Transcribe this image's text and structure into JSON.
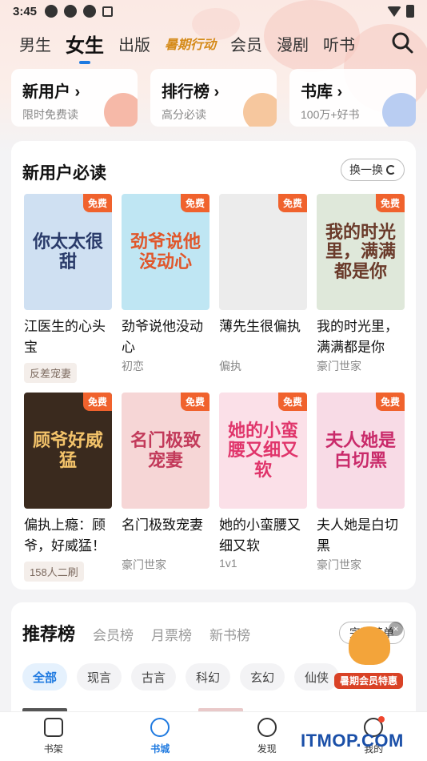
{
  "status_bar": {
    "time": "3:45"
  },
  "top_nav": {
    "tabs": [
      {
        "label": "男生",
        "active": false
      },
      {
        "label": "女生",
        "active": true
      },
      {
        "label": "出版",
        "active": false
      },
      {
        "label": "暑期行动",
        "active": false,
        "special": true
      },
      {
        "label": "会员",
        "active": false
      },
      {
        "label": "漫剧",
        "active": false
      },
      {
        "label": "听书",
        "active": false
      }
    ],
    "search_icon": "search-icon"
  },
  "quick_entries": [
    {
      "title": "新用户 ›",
      "subtitle": "限时免费读",
      "icon": "alarm-clock-icon",
      "icon_color": "#f6b9a8"
    },
    {
      "title": "排行榜 ›",
      "subtitle": "高分必读",
      "icon": "podium-icon",
      "icon_color": "#f6c79e"
    },
    {
      "title": "书库 ›",
      "subtitle": "100万+好书",
      "icon": "books-icon",
      "icon_color": "#b9cdf2"
    }
  ],
  "new_user_section": {
    "title": "新用户必读",
    "refresh_label": "换一换",
    "free_badge": "免费",
    "books": [
      {
        "cover_text": "你太太很甜",
        "name": "江医生的心头宝",
        "tag": "反差宠妻",
        "tag_chip": true,
        "cover_bg": "#cfe0f2",
        "cover_fg": "#2a3b6a"
      },
      {
        "cover_text": "劲爷说他没动心",
        "name": "劲爷说他没动心",
        "tag": "初恋",
        "tag_chip": false,
        "cover_bg": "#bfe6f3",
        "cover_fg": "#e0572b"
      },
      {
        "cover_text": "",
        "name": "薄先生很偏执",
        "tag": "偏执",
        "tag_chip": false,
        "cover_bg": "#ececec",
        "cover_fg": "#999999"
      },
      {
        "cover_text": "我的时光里，满满都是你",
        "name": "我的时光里，满满都是你",
        "tag": "豪门世家",
        "tag_chip": false,
        "cover_bg": "#dfe8da",
        "cover_fg": "#6a3a2a"
      },
      {
        "cover_text": "顾爷好威猛",
        "name": "偏执上瘾：顾爷，好威猛！",
        "tag": "158人二刷",
        "tag_chip": true,
        "cover_bg": "#3a2a1e",
        "cover_fg": "#f3c36a"
      },
      {
        "cover_text": "名门极致宠妻",
        "name": "名门极致宠妻",
        "tag": "豪门世家",
        "tag_chip": false,
        "cover_bg": "#f6d6d6",
        "cover_fg": "#c23a5a"
      },
      {
        "cover_text": "她的小蛮腰又细又软",
        "name": "她的小蛮腰又细又软",
        "tag": "1v1",
        "tag_chip": false,
        "cover_bg": "#fbe0e8",
        "cover_fg": "#e0356b"
      },
      {
        "cover_text": "夫人她是白切黑",
        "name": "夫人她是白切黑",
        "tag": "豪门世家",
        "tag_chip": false,
        "cover_bg": "#f8dbe6",
        "cover_fg": "#c92a6a"
      }
    ]
  },
  "ranking_section": {
    "tabs": [
      {
        "label": "推荐榜",
        "active": true
      },
      {
        "label": "会员榜",
        "active": false
      },
      {
        "label": "月票榜",
        "active": false
      },
      {
        "label": "新书榜",
        "active": false
      }
    ],
    "complete_label": "完整榜单",
    "categories": [
      {
        "label": "全部",
        "active": true
      },
      {
        "label": "现言",
        "active": false
      },
      {
        "label": "古言",
        "active": false
      },
      {
        "label": "科幻",
        "active": false
      },
      {
        "label": "玄幻",
        "active": false
      },
      {
        "label": "仙侠",
        "active": false
      }
    ]
  },
  "promo": {
    "label": "暑期会员特惠",
    "close": "×"
  },
  "tab_bar": [
    {
      "label": "书架",
      "icon": "bookshelf-icon",
      "active": false
    },
    {
      "label": "书城",
      "icon": "bookstore-icon",
      "active": true
    },
    {
      "label": "发现",
      "icon": "compass-icon",
      "active": false
    },
    {
      "label": "我的",
      "icon": "profile-icon",
      "active": false,
      "dot": true
    }
  ],
  "watermark": "ITMOP.COM",
  "colors": {
    "accent": "#1f7ae0",
    "free_badge": "#f0622d",
    "background": "#f3f3f5"
  }
}
